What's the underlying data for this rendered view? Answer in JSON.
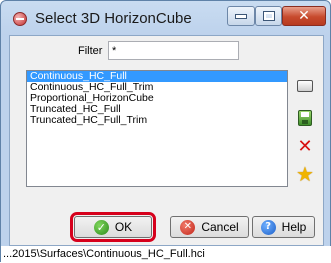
{
  "window": {
    "title": "Select 3D HorizonCube",
    "icons": {
      "app": "app-icon",
      "minimize": "minimize-icon",
      "maximize": "maximize-icon",
      "close": "close-icon"
    }
  },
  "filter": {
    "label": "Filter",
    "value": "*"
  },
  "list": {
    "items": [
      "Continuous_HC_Full",
      "Continuous_HC_Full_Trim",
      "Proportional_HorizonCube",
      "Truncated_HC_Full",
      "Truncated_HC_Full_Trim"
    ],
    "selected_index": 0
  },
  "side_buttons": [
    "rename-icon",
    "save-icon",
    "delete-icon",
    "set-default-star-icon"
  ],
  "buttons": {
    "ok_label": "OK",
    "cancel_label": "Cancel",
    "help_label": "Help"
  },
  "status": {
    "path": "...2015\\Surfaces\\Continuous_HC_Full.hci"
  },
  "colors": {
    "selection": "#3399ff",
    "highlight_outline": "#d6001c"
  }
}
